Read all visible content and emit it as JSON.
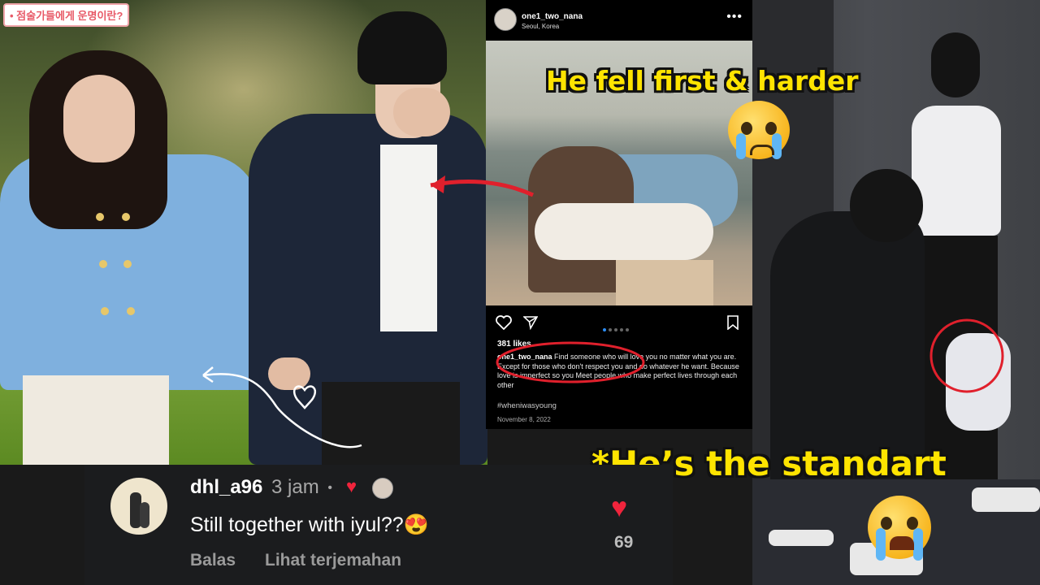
{
  "left_photo": {
    "title_tag": "• 점술가들에게 운명이란?"
  },
  "instagram": {
    "username": "one1_two_nana",
    "location": "Seoul, Korea",
    "more": "•••",
    "likes": "381 likes",
    "caption_user": "one1_two_nana",
    "caption": "Find someone who will love you no matter what you are. Except for those who don't respect you and do whatever he want. Because love is imperfect so you Meet people who make perfect lives through each other",
    "hashtag": "#wheniwasyoung",
    "date": "November 8, 2022",
    "icons": {
      "like": "heart-outline-icon",
      "share": "send-icon",
      "save": "bookmark-icon"
    },
    "carousel_dots": 5,
    "carousel_active": 1
  },
  "overlays": {
    "top_caption": "He fell first & harder",
    "bottom_caption": "*He’s the standart"
  },
  "comment": {
    "username": "dhl_a96",
    "time": "3 jam",
    "separator": "•",
    "text": "Still together with iyul??😍",
    "reply": "Balas",
    "translate": "Lihat terjemahan",
    "like_count": "69",
    "heart_glyph": "♥"
  },
  "colors": {
    "caption_yellow": "#ffe400",
    "annotation_red": "#e0202c",
    "heart_red": "#f0243c",
    "comment_bg": "#1b1c1e"
  }
}
